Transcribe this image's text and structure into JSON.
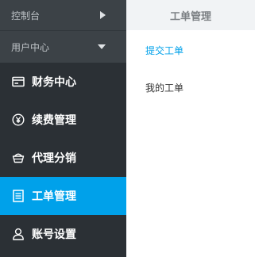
{
  "sidebar": {
    "top": [
      {
        "label": "控制台",
        "arrow": "chevron-right-icon"
      },
      {
        "label": "用户中心",
        "arrow": "chevron-down-icon"
      }
    ],
    "items": [
      {
        "label": "财务中心",
        "icon": "wallet-icon",
        "active": false
      },
      {
        "label": "续费管理",
        "icon": "yen-circle-icon",
        "active": false
      },
      {
        "label": "代理分销",
        "icon": "basket-icon",
        "active": false
      },
      {
        "label": "工单管理",
        "icon": "document-icon",
        "active": true
      },
      {
        "label": "账号设置",
        "icon": "user-icon",
        "active": false
      }
    ],
    "active_color": "#00a1ea",
    "background_color": "#2b3035"
  },
  "panel": {
    "title": "工单管理",
    "items": [
      {
        "label": "提交工单",
        "active": true
      },
      {
        "label": "我的工单",
        "active": false
      }
    ]
  }
}
